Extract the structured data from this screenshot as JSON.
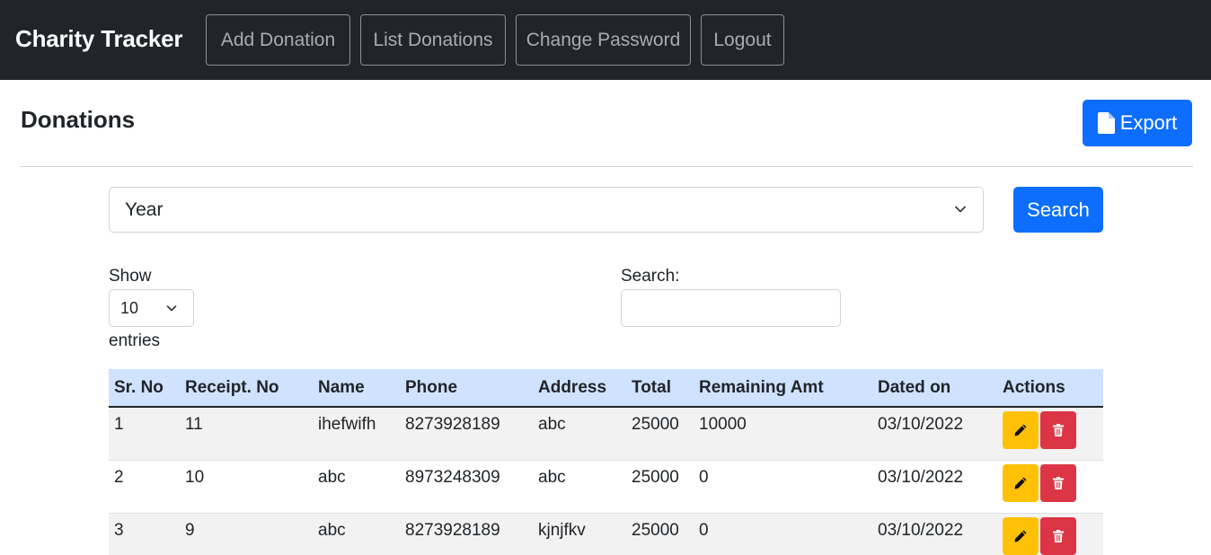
{
  "navbar": {
    "brand": "Charity Tracker",
    "links": [
      "Add Donation",
      "List Donations",
      "Change Password",
      "Logout"
    ]
  },
  "page": {
    "title": "Donations",
    "export_label": "Export"
  },
  "filter": {
    "year_selected": "Year",
    "search_label": "Search"
  },
  "table_controls": {
    "show_label": "Show",
    "length_value": "10",
    "entries_label": "entries",
    "search_label": "Search:",
    "search_value": ""
  },
  "table": {
    "columns": [
      "Sr. No",
      "Receipt. No",
      "Name",
      "Phone",
      "Address",
      "Total",
      "Remaining Amt",
      "Dated on",
      "Actions"
    ],
    "rows": [
      [
        "1",
        "11",
        "ihefwifh",
        "8273928189",
        "abc",
        "25000",
        "10000",
        "03/10/2022"
      ],
      [
        "2",
        "10",
        "abc",
        "8973248309",
        "abc",
        "25000",
        "0",
        "03/10/2022"
      ],
      [
        "3",
        "9",
        "abc",
        "8273928189",
        "kjnjfkv",
        "25000",
        "0",
        "03/10/2022"
      ]
    ]
  },
  "colors": {
    "navbar_bg": "#212529",
    "primary": "#0d6efd",
    "warning": "#ffc107",
    "danger": "#dc3545",
    "table_header_bg": "#cfe2ff"
  },
  "icons": {
    "export": "file-icon",
    "edit": "pencil-icon",
    "delete": "trash-icon",
    "dropdown": "chevron-down-icon"
  }
}
